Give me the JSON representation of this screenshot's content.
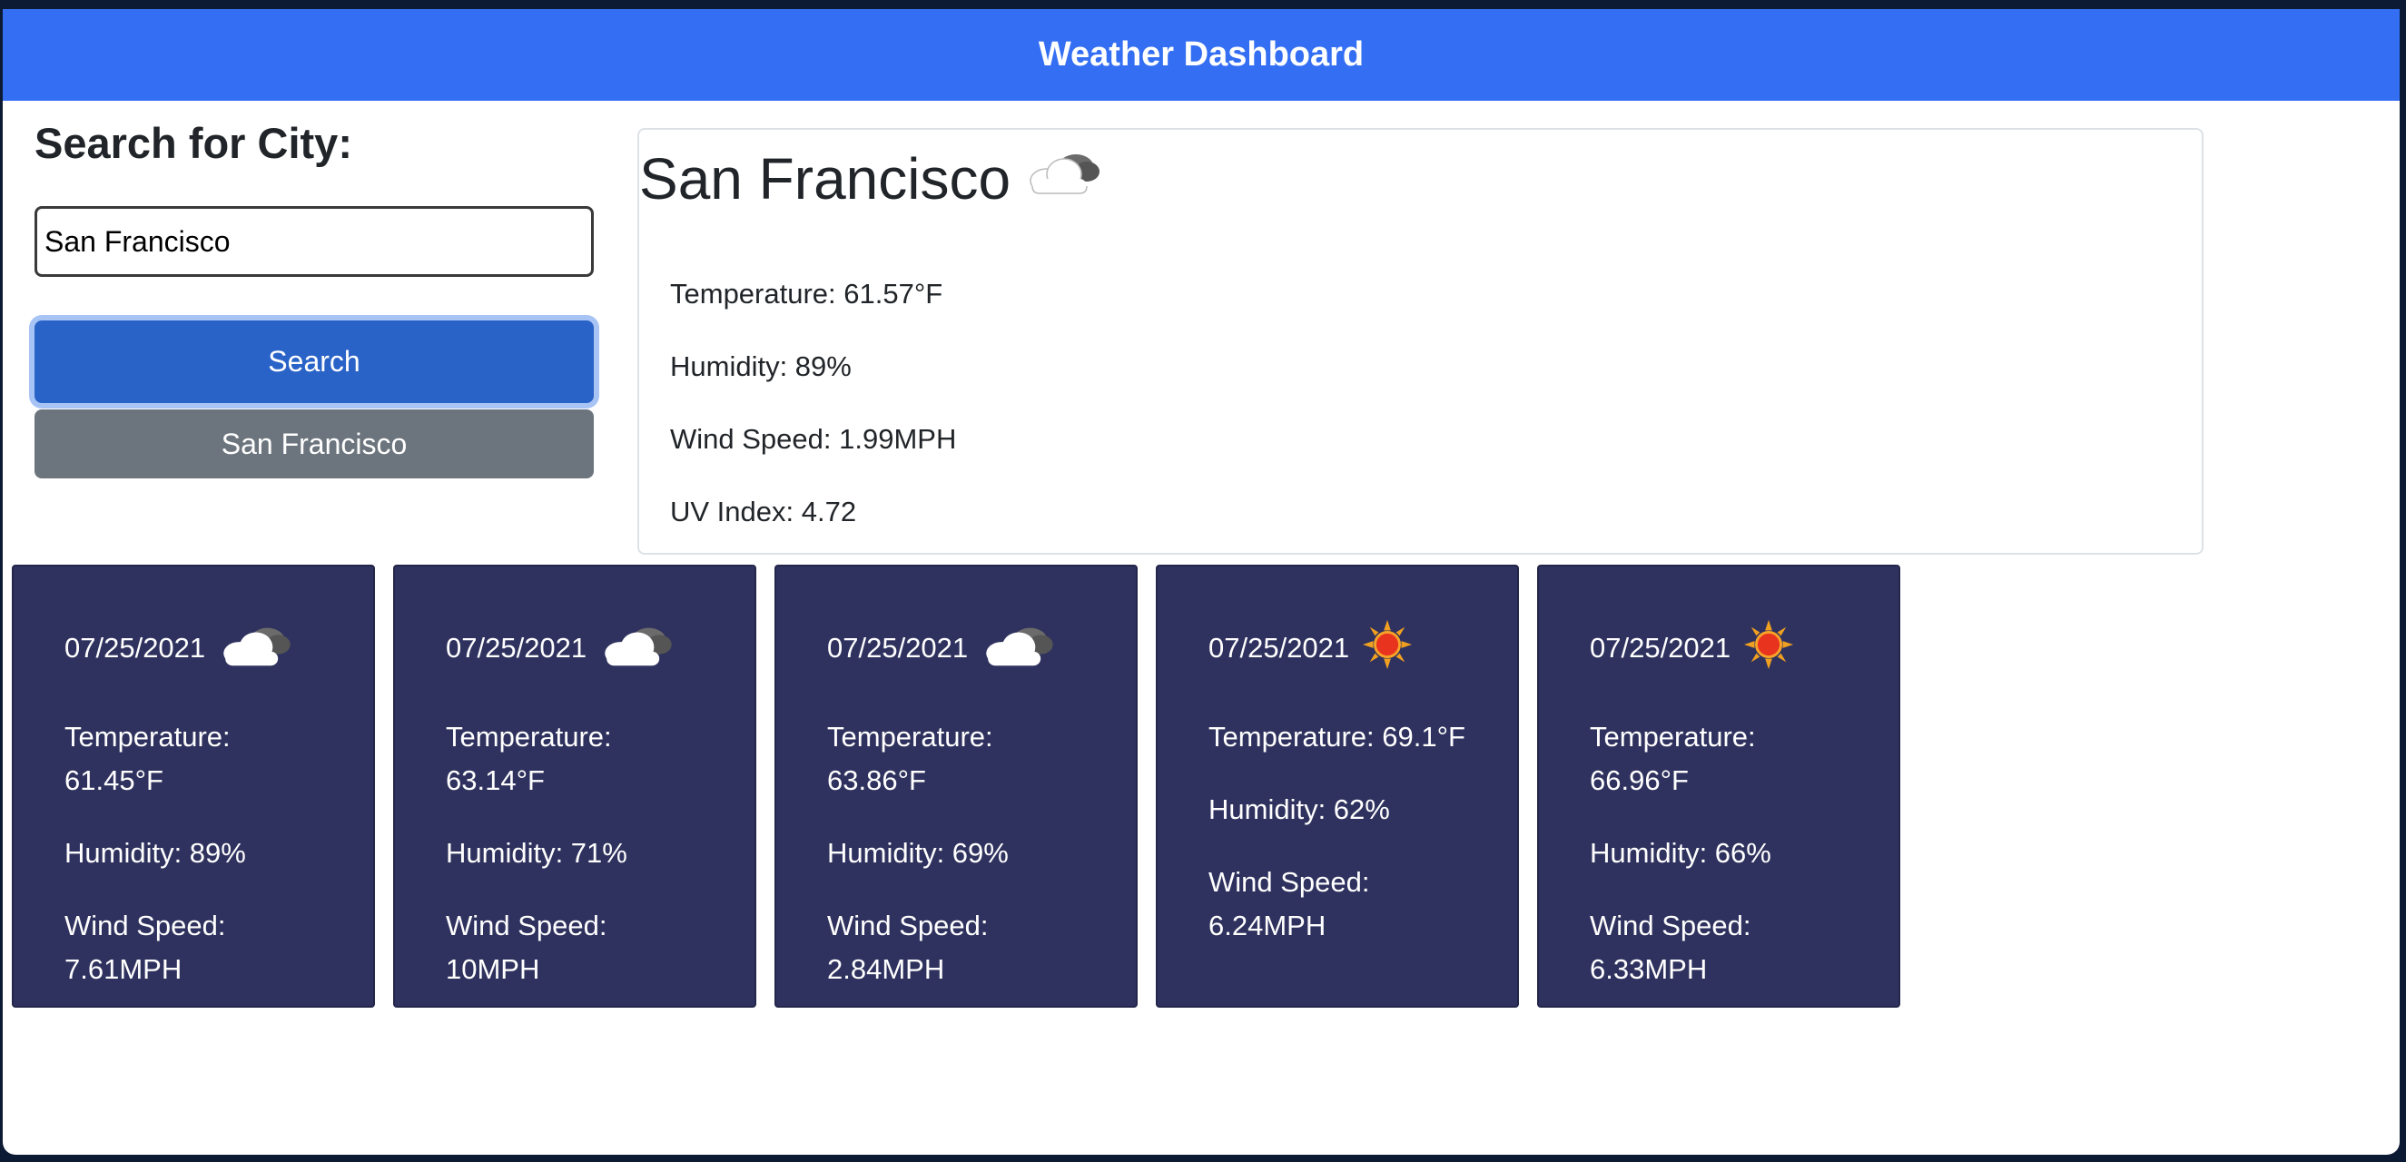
{
  "header": {
    "title": "Weather Dashboard"
  },
  "search": {
    "heading": "Search for City:",
    "input_value": "San Francisco",
    "button_label": "Search",
    "history": [
      "San Francisco"
    ]
  },
  "current": {
    "city": "San Francisco",
    "icon": "cloudy-icon",
    "temperature": "Temperature: 61.57°F",
    "humidity": "Humidity: 89%",
    "wind": "Wind Speed: 1.99MPH",
    "uv": "UV Index: 4.72"
  },
  "forecast": [
    {
      "date": "07/25/2021",
      "icon": "cloudy-icon",
      "temp_label": "Temperature:",
      "temp": "61.45°F",
      "humidity": "Humidity: 89%",
      "wind_label": "Wind Speed:",
      "wind": "7.61MPH"
    },
    {
      "date": "07/25/2021",
      "icon": "cloudy-icon",
      "temp_label": "Temperature:",
      "temp": "63.14°F",
      "humidity": "Humidity: 71%",
      "wind_label": "Wind Speed:",
      "wind": "10MPH"
    },
    {
      "date": "07/25/2021",
      "icon": "cloudy-icon",
      "temp_label": "Temperature:",
      "temp": "63.86°F",
      "humidity": "Humidity: 69%",
      "wind_label": "Wind Speed:",
      "wind": "2.84MPH"
    },
    {
      "date": "07/25/2021",
      "icon": "sun-icon",
      "temp_full": "Temperature: 69.1°F",
      "humidity": "Humidity: 62%",
      "wind_label": "Wind Speed:",
      "wind": "6.24MPH"
    },
    {
      "date": "07/25/2021",
      "icon": "sun-icon",
      "temp_label": "Temperature:",
      "temp": "66.96°F",
      "humidity": "Humidity: 66%",
      "wind_label": "Wind Speed:",
      "wind": "6.33MPH"
    }
  ],
  "colors": {
    "header": "#346ff3",
    "search_button": "#2a63c8",
    "history_button": "#6c757d",
    "forecast_card": "#2f325e"
  }
}
